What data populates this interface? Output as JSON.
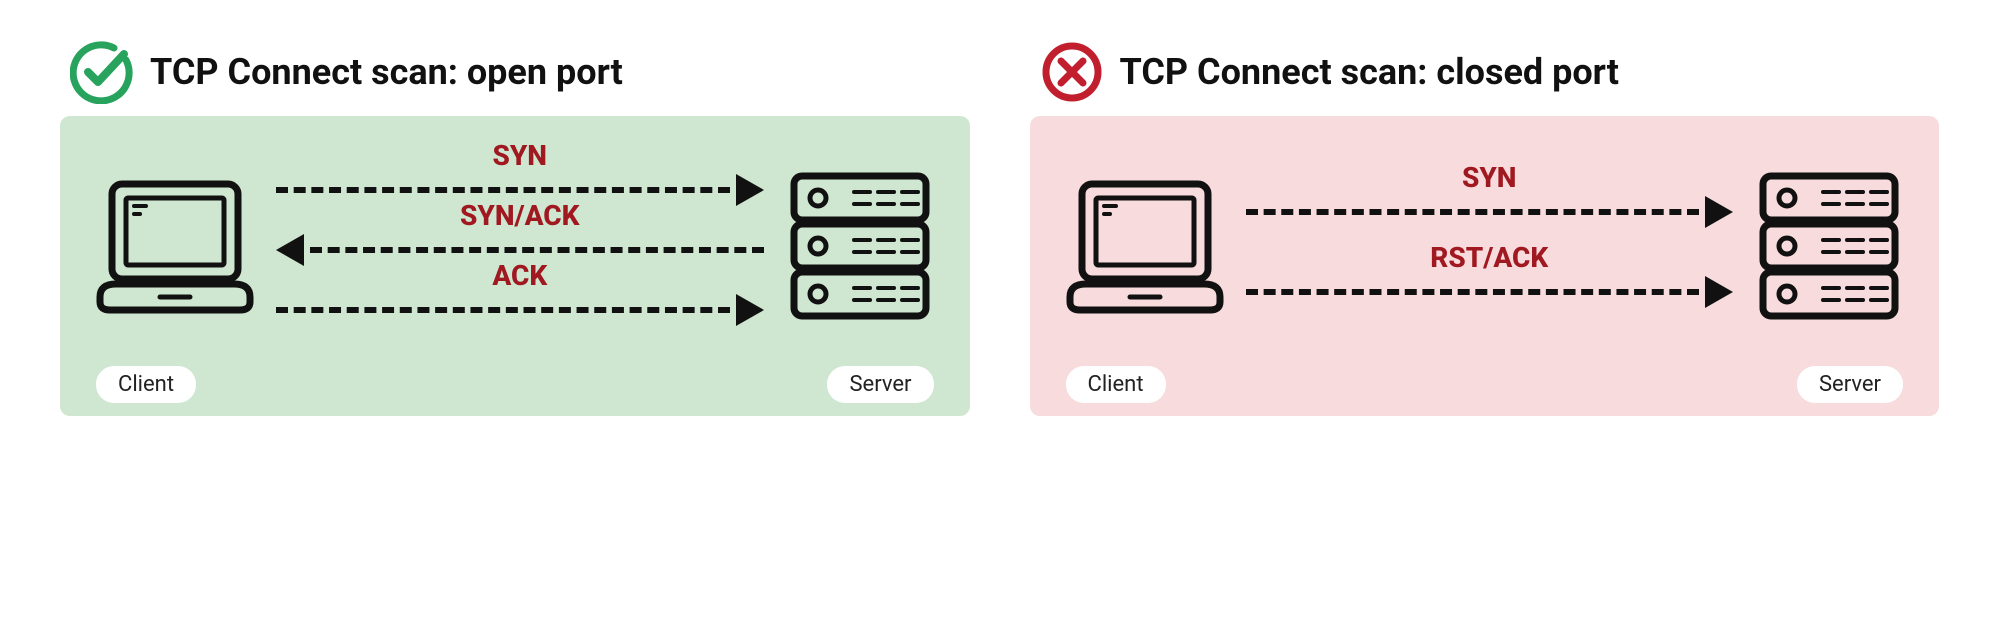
{
  "left": {
    "title": "TCP Connect scan: open port",
    "client_label": "Client",
    "server_label": "Server",
    "packets": [
      "SYN",
      "SYN/ACK",
      "ACK"
    ],
    "directions": [
      "right",
      "left",
      "right"
    ],
    "status": "open"
  },
  "right": {
    "title": "TCP Connect scan: closed port",
    "client_label": "Client",
    "server_label": "Server",
    "packets": [
      "SYN",
      "RST/ACK"
    ],
    "directions": [
      "right",
      "right"
    ],
    "status": "closed"
  },
  "colors": {
    "ok": "#27a35e",
    "fail": "#c21f2e",
    "packet_text": "#a01820",
    "open_bg": "#cfe6d0",
    "closed_bg": "#f8dbdc"
  }
}
